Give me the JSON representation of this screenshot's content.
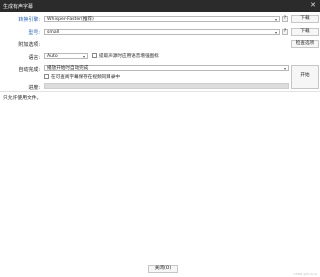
{
  "window": {
    "title": "生成有声字幕"
  },
  "model": {
    "label": "转换引擎:",
    "value": "Whisper-Faster(推荐)",
    "help": "?",
    "download_label": "下载"
  },
  "model_type": {
    "label": "型号:",
    "value": "small",
    "help": "?",
    "download_label": "下载"
  },
  "extra_options": {
    "label": "附加选项:",
    "check_button": "检查选项"
  },
  "language": {
    "label": "语言:",
    "value": "Auto",
    "extract_vocal_label": "提取声源时应用语音增强图标"
  },
  "auto_generate": {
    "label": "自动完成:",
    "value": "播放开始时自动完成",
    "save_subtitle_label": "在可查阅字幕保存在视频同目录中",
    "start_button": "开始"
  },
  "progress": {
    "label": "进度:",
    "fraction": 1.0
  },
  "status_text": "只允许使用文件。",
  "footer": {
    "close_button": "关闭(O)"
  },
  "watermark": "CSDN @Hi-Ai-Ai"
}
